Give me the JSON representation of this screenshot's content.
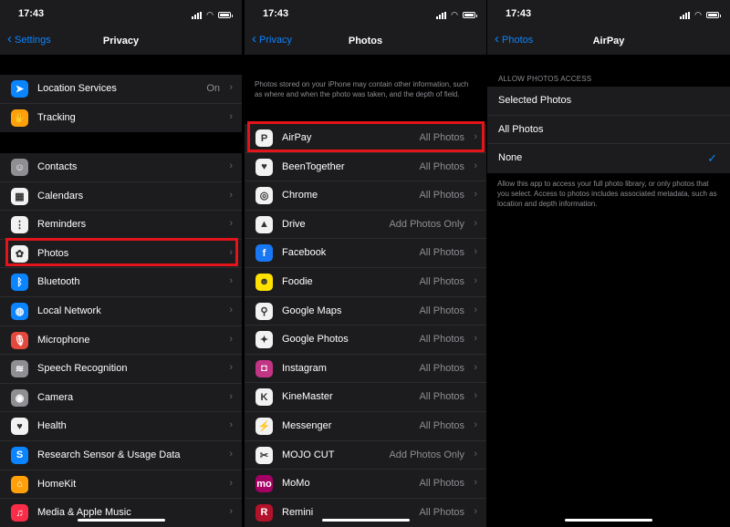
{
  "status_time": "17:43",
  "panel1": {
    "back": "Settings",
    "title": "Privacy",
    "group1": [
      {
        "label": "Location Services",
        "value": "On",
        "icon": "location-arrow-icon",
        "color": "#0a84ff",
        "glyph": "➤"
      },
      {
        "label": "Tracking",
        "value": "",
        "icon": "tracking-icon",
        "color": "#ff9f0a",
        "glyph": "✋"
      }
    ],
    "group2": [
      {
        "label": "Contacts",
        "icon": "contacts-icon",
        "color": "#8e8e93",
        "glyph": "☺"
      },
      {
        "label": "Calendars",
        "icon": "calendar-icon",
        "color": "#f2f2f2",
        "glyph": "▦"
      },
      {
        "label": "Reminders",
        "icon": "reminders-icon",
        "color": "#f2f2f2",
        "glyph": "⋮"
      },
      {
        "label": "Photos",
        "icon": "photos-flower-icon",
        "color": "#f2f2f2",
        "glyph": "✿"
      },
      {
        "label": "Bluetooth",
        "icon": "bluetooth-icon",
        "color": "#0a84ff",
        "glyph": "ᛒ"
      },
      {
        "label": "Local Network",
        "icon": "globe-icon",
        "color": "#0a84ff",
        "glyph": "◍"
      },
      {
        "label": "Microphone",
        "icon": "microphone-icon",
        "color": "#e5483c",
        "glyph": "🎙"
      },
      {
        "label": "Speech Recognition",
        "icon": "waveform-icon",
        "color": "#8e8e93",
        "glyph": "≋"
      },
      {
        "label": "Camera",
        "icon": "camera-icon",
        "color": "#8e8e93",
        "glyph": "◉"
      },
      {
        "label": "Health",
        "icon": "heart-icon",
        "color": "#f2f2f2",
        "glyph": "♥"
      },
      {
        "label": "Research Sensor & Usage Data",
        "icon": "research-icon",
        "color": "#0a84ff",
        "glyph": "S"
      },
      {
        "label": "HomeKit",
        "icon": "home-icon",
        "color": "#ff9f0a",
        "glyph": "⌂"
      },
      {
        "label": "Media & Apple Music",
        "icon": "music-note-icon",
        "color": "#fa2d48",
        "glyph": "♫"
      }
    ]
  },
  "panel2": {
    "back": "Privacy",
    "title": "Photos",
    "note": "Photos stored on your iPhone may contain other information, such as where and when the photo was taken, and the depth of field.",
    "apps": [
      {
        "label": "AirPay",
        "value": "All Photos",
        "icon": "airpay-app-icon",
        "color": "#f2f2f2",
        "glyph": "P"
      },
      {
        "label": "BeenTogether",
        "value": "All Photos",
        "icon": "beentogether-heart-icon",
        "color": "#f2f2f2",
        "glyph": "♥"
      },
      {
        "label": "Chrome",
        "value": "All Photos",
        "icon": "chrome-icon",
        "color": "#f2f2f2",
        "glyph": "◎"
      },
      {
        "label": "Drive",
        "value": "Add Photos Only",
        "icon": "drive-icon",
        "color": "#f2f2f2",
        "glyph": "▲"
      },
      {
        "label": "Facebook",
        "value": "All Photos",
        "icon": "facebook-icon",
        "color": "#1877f2",
        "glyph": "f"
      },
      {
        "label": "Foodie",
        "value": "All Photos",
        "icon": "foodie-icon",
        "color": "#ffe100",
        "glyph": "☻"
      },
      {
        "label": "Google Maps",
        "value": "All Photos",
        "icon": "google-maps-icon",
        "color": "#f2f2f2",
        "glyph": "⚲"
      },
      {
        "label": "Google Photos",
        "value": "All Photos",
        "icon": "google-photos-icon",
        "color": "#f2f2f2",
        "glyph": "✦"
      },
      {
        "label": "Instagram",
        "value": "All Photos",
        "icon": "instagram-icon",
        "color": "#c13584",
        "glyph": "◘"
      },
      {
        "label": "KineMaster",
        "value": "All Photos",
        "icon": "kinemaster-icon",
        "color": "#f2f2f2",
        "glyph": "K"
      },
      {
        "label": "Messenger",
        "value": "All Photos",
        "icon": "messenger-icon",
        "color": "#f2f2f2",
        "glyph": "⚡"
      },
      {
        "label": "MOJO CUT",
        "value": "Add Photos Only",
        "icon": "mojo-cut-icon",
        "color": "#f2f2f2",
        "glyph": "✂"
      },
      {
        "label": "MoMo",
        "value": "All Photos",
        "icon": "momo-icon",
        "color": "#a50064",
        "glyph": "mo"
      },
      {
        "label": "Remini",
        "value": "All Photos",
        "icon": "remini-icon",
        "color": "#b3122b",
        "glyph": "R"
      }
    ]
  },
  "panel3": {
    "back": "Photos",
    "title": "AirPay",
    "header": "ALLOW PHOTOS ACCESS",
    "options": [
      {
        "label": "Selected Photos",
        "checked": false
      },
      {
        "label": "All Photos",
        "checked": false
      },
      {
        "label": "None",
        "checked": true
      }
    ],
    "checkmark": "✓",
    "note": "Allow this app to access your full photo library, or only photos that you select. Access to photos includes associated metadata, such as location and depth information."
  },
  "colors": {
    "accent": "#0a84ff",
    "highlight": "#e3141a",
    "cell_bg": "#1c1c1e",
    "secondary_text": "#8e8e93"
  }
}
